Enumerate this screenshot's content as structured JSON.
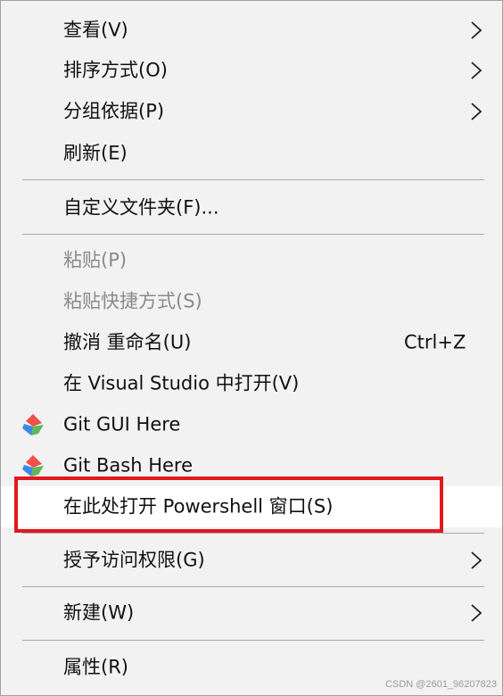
{
  "menu": {
    "items": [
      {
        "label": "查看(V)"
      },
      {
        "label": "排序方式(O)"
      },
      {
        "label": "分组依据(P)"
      },
      {
        "label": "刷新(E)"
      },
      {
        "label": "自定义文件夹(F)..."
      },
      {
        "label": "粘贴(P)",
        "disabled": true
      },
      {
        "label": "粘贴快捷方式(S)",
        "disabled": true
      },
      {
        "label": "撤消 重命名(U)",
        "shortcut": "Ctrl+Z"
      },
      {
        "label": "在 Visual Studio 中打开(V)"
      },
      {
        "label": "Git GUI Here",
        "icon": "git-gui-icon"
      },
      {
        "label": "Git Bash Here",
        "icon": "git-bash-icon"
      },
      {
        "label": "在此处打开 Powershell 窗口(S)",
        "highlighted": true
      },
      {
        "label": "授予访问权限(G)"
      },
      {
        "label": "新建(W)"
      },
      {
        "label": "属性(R)"
      }
    ]
  },
  "colors": {
    "menu_background": "#f2f2f2",
    "highlight_background": "#ffffff",
    "callout_border": "#e0191f",
    "disabled_text": "#8a8a8a",
    "separator": "#a9a9a9"
  },
  "watermark": "CSDN @2601_96207823"
}
